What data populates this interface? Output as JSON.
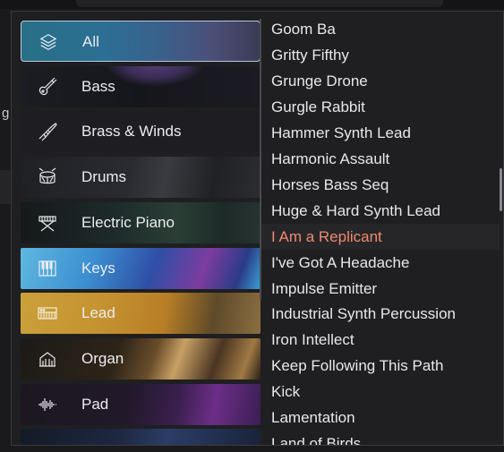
{
  "background": {
    "partial_text": "g"
  },
  "categories": [
    {
      "label": "All",
      "icon": "layers-icon",
      "selected": true
    },
    {
      "label": "Bass",
      "icon": "bass-guitar-icon"
    },
    {
      "label": "Brass & Winds",
      "icon": "trumpet-icon"
    },
    {
      "label": "Drums",
      "icon": "drum-icon"
    },
    {
      "label": "Electric Piano",
      "icon": "electric-piano-icon"
    },
    {
      "label": "Keys",
      "icon": "piano-keys-icon"
    },
    {
      "label": "Lead",
      "icon": "lead-synth-icon"
    },
    {
      "label": "Organ",
      "icon": "organ-icon"
    },
    {
      "label": "Pad",
      "icon": "waveform-icon"
    }
  ],
  "presets": [
    {
      "label": "Goom Ba"
    },
    {
      "label": "Gritty Fifthy"
    },
    {
      "label": "Grunge Drone"
    },
    {
      "label": "Gurgle Rabbit"
    },
    {
      "label": "Hammer Synth Lead"
    },
    {
      "label": "Harmonic Assault"
    },
    {
      "label": "Horses Bass Seq"
    },
    {
      "label": "Huge & Hard Synth Lead"
    },
    {
      "label": "I Am a Replicant",
      "active": true
    },
    {
      "label": "I've Got A Headache"
    },
    {
      "label": "Impulse Emitter"
    },
    {
      "label": "Industrial Synth Percussion"
    },
    {
      "label": "Iron Intellect"
    },
    {
      "label": "Keep Following This Path"
    },
    {
      "label": "Kick"
    },
    {
      "label": "Lamentation"
    },
    {
      "label": "Land of Birds"
    }
  ],
  "colors": {
    "active_preset": "#f0896e",
    "selected_border": "#b9c7d6"
  }
}
